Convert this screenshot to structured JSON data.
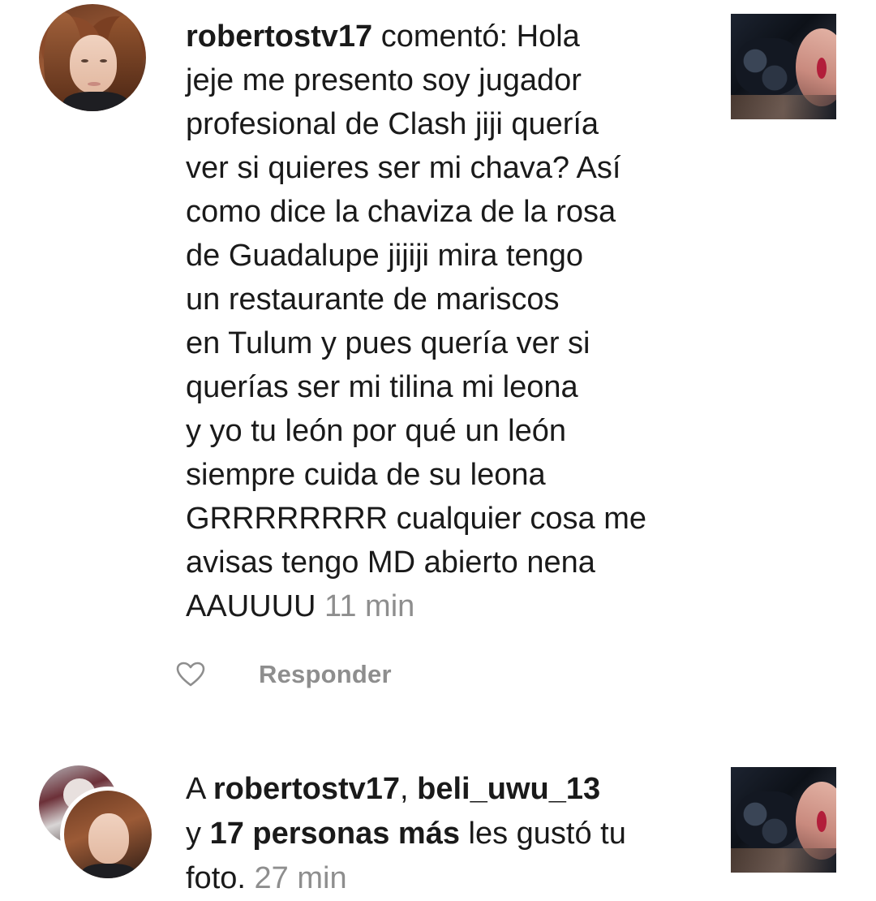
{
  "comment": {
    "username": "robertostv17",
    "verb": " comentó: ",
    "lines": [
      "Hola",
      "jeje me presento soy jugador",
      "profesional de Clash jiji quería",
      "ver si quieres ser mi chava? Así",
      "como dice la chaviza de la rosa",
      "de Guadalupe jijiji mira tengo",
      "un restaurante de mariscos",
      "en Tulum y pues quería ver si",
      "querías ser mi tilina mi leona",
      "y yo tu león por qué un león",
      "siempre cuida de su leona",
      "GRRRRRRRR cualquier cosa me",
      "avisas tengo MD abierto nena",
      "AAUUUU"
    ],
    "time": "11 min",
    "avatar_icon": "profile-photo",
    "thumbnail_icon": "post-thumbnail"
  },
  "actions": {
    "like_icon": "heart-outline",
    "reply_label": "Responder"
  },
  "notification": {
    "prefix": "A ",
    "user1": "robertostv17",
    "separator": ", ",
    "user2": "beli_uwu_13",
    "line2_prefix": "y ",
    "others": "17 personas más",
    "suffix": " les gustó tu",
    "line3": "foto.",
    "time": "27 min"
  },
  "colors": {
    "text": "#1a1a1a",
    "muted": "#8e8e8e",
    "background": "#ffffff"
  }
}
